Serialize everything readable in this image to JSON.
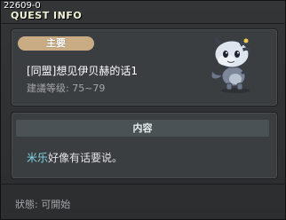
{
  "window": {
    "quest_id": "22609-0",
    "title": "QUEST INFO"
  },
  "quest": {
    "tag": "主要",
    "name": "[同盟]想见伊贝赫的话1",
    "level": "建議等级: 75~79",
    "npc_sprite_icon": "dragon-npc-icon"
  },
  "content": {
    "header": "内容",
    "npc_name": "米乐",
    "message": "好像有话要说。"
  },
  "status": {
    "text": "狀態: 可開始"
  },
  "colors": {
    "tag_bg": "#c9ac83",
    "npc_name": "#7fd6e8",
    "header_bg": "#4a5256"
  }
}
